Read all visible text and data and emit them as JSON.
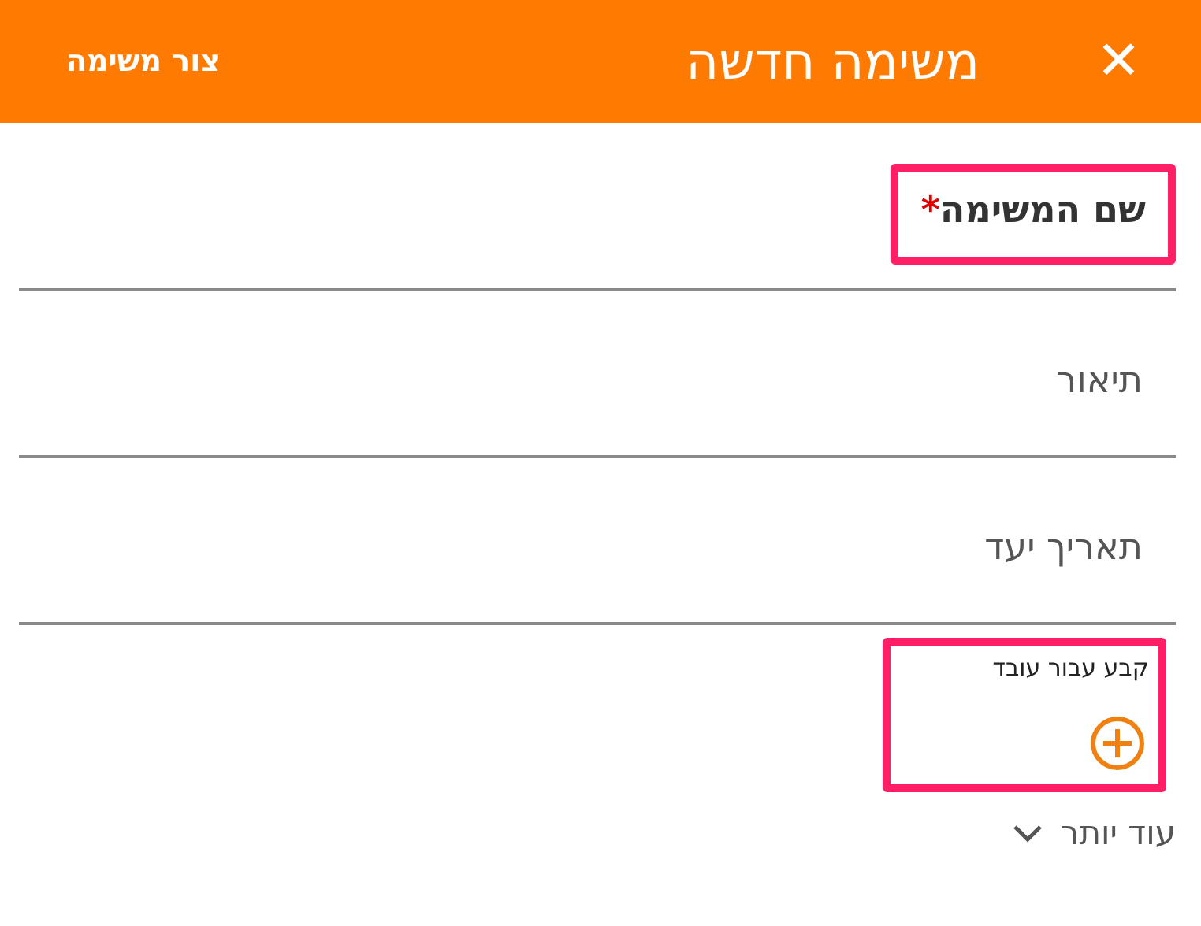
{
  "header": {
    "close_icon": "✕",
    "title": "משימה חדשה",
    "action": "צור משימה"
  },
  "fields": [
    {
      "label": "שם המשימה",
      "required_mark": "*",
      "bold": true,
      "highlighted": true
    },
    {
      "label": "תיאור",
      "bold": false,
      "highlighted": false
    },
    {
      "label": "תאריך יעד",
      "bold": false,
      "highlighted": false
    }
  ],
  "assign": {
    "label": "קבע עבור עובד",
    "highlighted": true
  },
  "more": {
    "label": "עוד יותר"
  }
}
